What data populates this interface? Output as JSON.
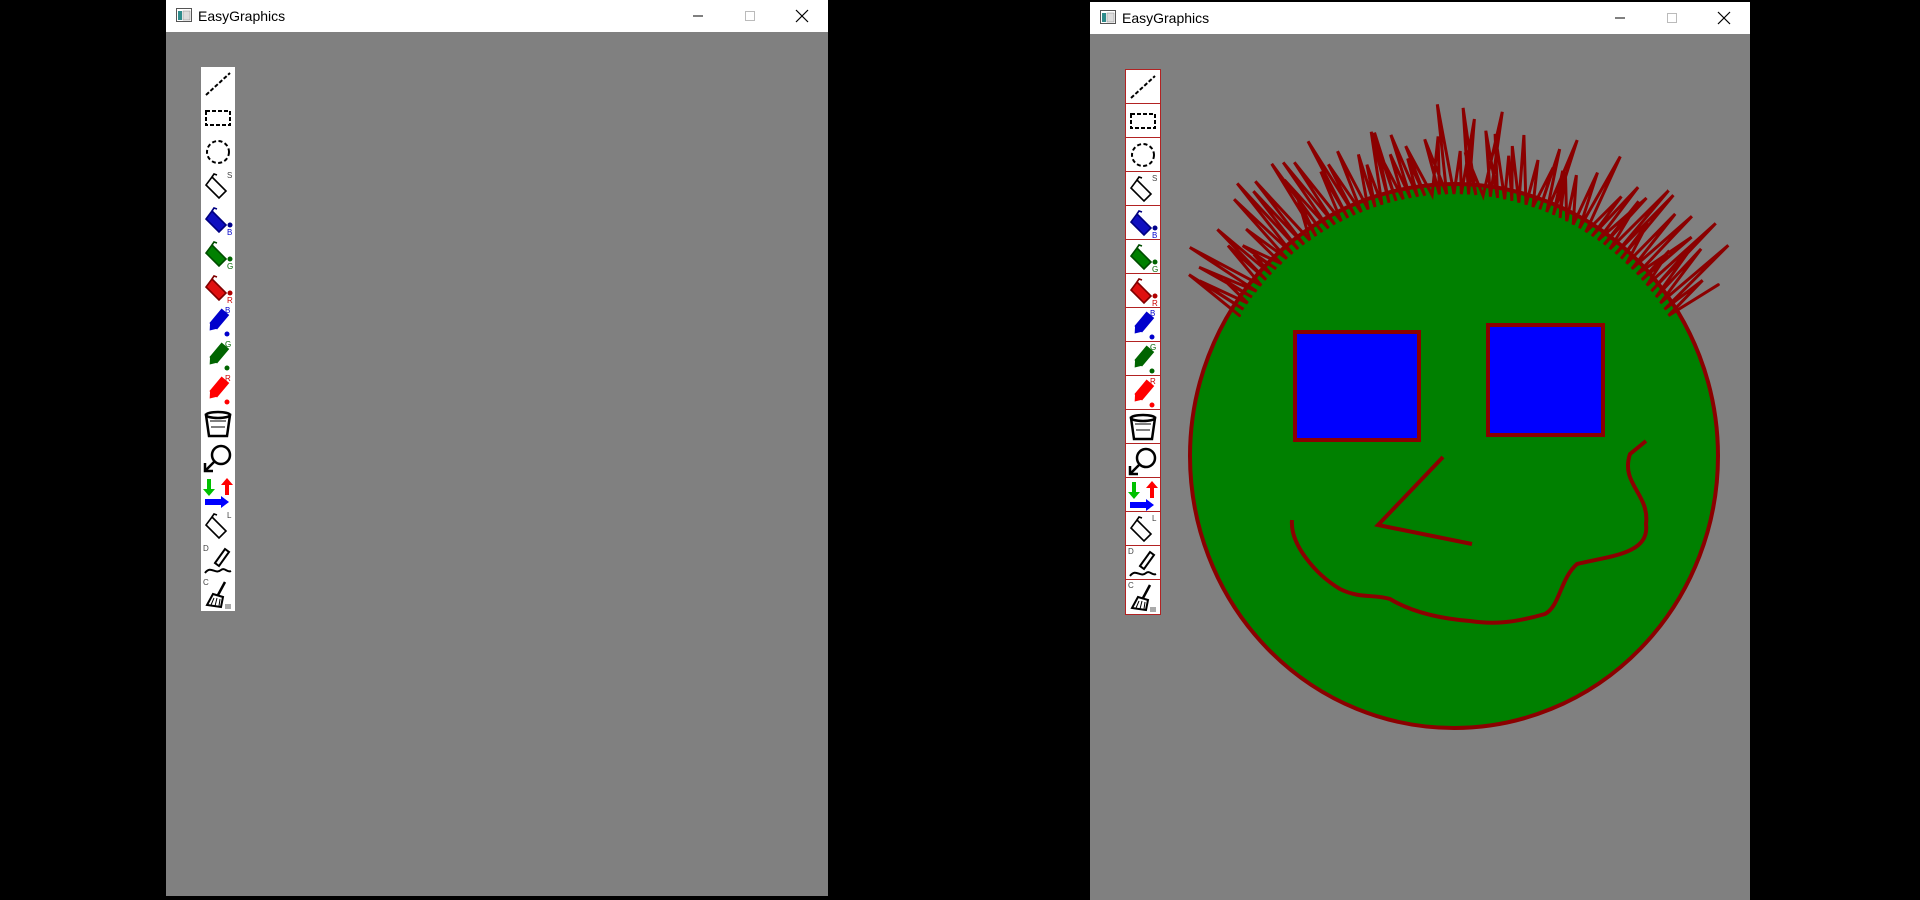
{
  "windows": [
    {
      "id": "left",
      "title": "EasyGraphics",
      "state": "blank canvas"
    },
    {
      "id": "right",
      "title": "EasyGraphics",
      "state": "drawing"
    }
  ],
  "toolbar": {
    "tools": [
      {
        "name": "line-tool",
        "icon": "dashed-line-icon",
        "letter": ""
      },
      {
        "name": "rectangle-tool",
        "icon": "dashed-rectangle-icon",
        "letter": ""
      },
      {
        "name": "ellipse-tool",
        "icon": "dashed-circle-icon",
        "letter": ""
      },
      {
        "name": "fill-black-tool",
        "icon": "paint-bucket-icon",
        "letter": "S"
      },
      {
        "name": "fill-blue-tool",
        "icon": "paint-bucket-blue-icon",
        "letter": "B"
      },
      {
        "name": "fill-green-tool",
        "icon": "paint-bucket-green-icon",
        "letter": "G"
      },
      {
        "name": "fill-red-tool",
        "icon": "paint-bucket-red-icon",
        "letter": "R"
      },
      {
        "name": "pen-blue-tool",
        "icon": "marker-blue-icon",
        "letter": "B"
      },
      {
        "name": "pen-green-tool",
        "icon": "marker-green-icon",
        "letter": "G"
      },
      {
        "name": "pen-red-tool",
        "icon": "marker-red-icon",
        "letter": "R"
      },
      {
        "name": "trash-tool",
        "icon": "trash-bin-icon",
        "letter": ""
      },
      {
        "name": "select-tool",
        "icon": "pointer-hand-icon",
        "letter": ""
      },
      {
        "name": "import-export-tool",
        "icon": "arrows-icon",
        "letter": ""
      },
      {
        "name": "fill-outline-tool",
        "icon": "paint-bucket-outline-icon",
        "letter": "L"
      },
      {
        "name": "freehand-tool",
        "icon": "pen-squiggle-icon",
        "letter": "D"
      },
      {
        "name": "clear-tool",
        "icon": "broom-icon",
        "letter": "C"
      }
    ]
  },
  "colors": {
    "canvas": "#808080",
    "face_fill": "#008000",
    "outline": "#8b0000",
    "eye_fill": "#0000ff",
    "hair": "#8b0000"
  }
}
